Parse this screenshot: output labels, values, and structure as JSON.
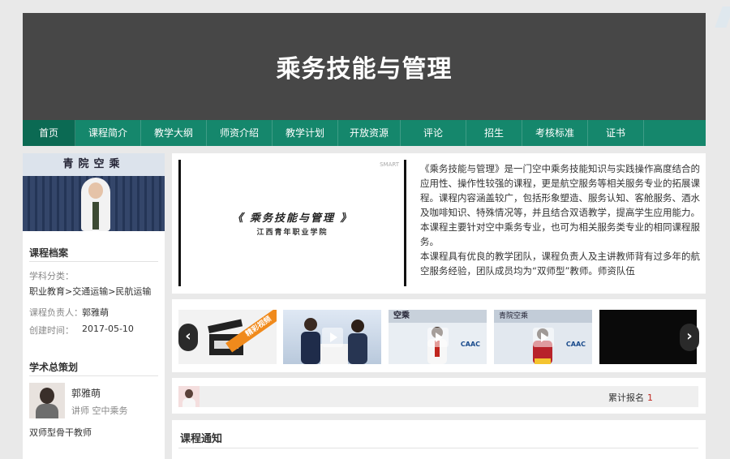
{
  "header": {
    "title": "乘务技能与管理"
  },
  "nav": [
    {
      "label": "首页",
      "active": true
    },
    {
      "label": "课程简介"
    },
    {
      "label": "教学大纲"
    },
    {
      "label": "师资介绍"
    },
    {
      "label": "教学计划"
    },
    {
      "label": "开放资源"
    },
    {
      "label": "评论"
    },
    {
      "label": "招生"
    },
    {
      "label": "考核标准"
    },
    {
      "label": "证书"
    }
  ],
  "sidebar": {
    "photo_sign": "青院空乘",
    "archive_title": "课程档案",
    "subject_label": "学科分类：",
    "subject_value": "职业教育>交通运输>民航运输",
    "owner_label": "课程负责人：",
    "owner_value": "郭雅萌",
    "created_label": "创建时间：",
    "created_value": "2017-05-10",
    "planner_title": "学术总策划",
    "planner_name": "郭雅萌",
    "planner_role": "讲师 空中乘务",
    "planner_note": "双师型骨干教师"
  },
  "video": {
    "watermark": "SMART",
    "title": "《 乘务技能与管理 》",
    "subtitle": "江西青年职业学院"
  },
  "description": {
    "p1": "《乘务技能与管理》是一门空中乘务技能知识与实践操作高度结合的应用性、操作性较强的课程，更是航空服务等相关服务专业的拓展课程。课程内容涵盖较广，包括形象塑造、服务认知、客舱服务、酒水及咖啡知识、特殊情况等，并且结合双语教学，提高学生应用能力。本课程主要针对空中乘务专业，也可为相关服务类专业的相同课程服务。",
    "p2": "本课程具有优良的教学团队，课程负责人及主讲教师背有过多年的航空服务经验，团队成员均为“双师型”教师。师资队伍"
  },
  "carousel": {
    "prev_symbol": "‹",
    "next_symbol": "›",
    "badge": "精彩视频",
    "thumb_sign_1": "空乘",
    "thumb_sign_2": "青院空乘",
    "caac": "CAAC"
  },
  "stats": {
    "label": "累计报名",
    "value": "1"
  },
  "notice": {
    "title": "课程通知"
  }
}
